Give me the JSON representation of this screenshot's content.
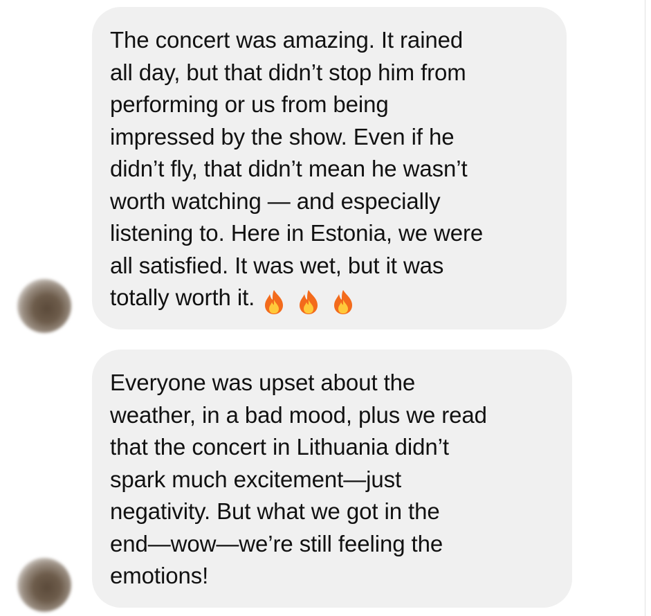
{
  "messages": [
    {
      "lines": [
        "The concert was amazing. It rained",
        "all day, but that didn’t stop him from",
        "performing or us from being",
        "impressed by the show. Even if he",
        "didn’t fly, that didn’t mean he wasn’t",
        "worth watching — and especially",
        "listening to. Here in Estonia, we were",
        "all satisfied. It was wet, but it was",
        "totally worth it."
      ],
      "emoji": [
        "fire-emoji",
        "fire-emoji",
        "fire-emoji"
      ]
    },
    {
      "lines": [
        "Everyone was upset about the",
        "weather, in a bad mood, plus we read",
        "that the concert in Lithuania didn’t",
        "spark much excitement—just",
        "negativity. But what we got in the",
        "end—wow—we’re still feeling the",
        "emotions!"
      ]
    }
  ],
  "colors": {
    "bubble_background": "#f0f0f0",
    "text": "#111111",
    "page_background": "#ffffff"
  }
}
